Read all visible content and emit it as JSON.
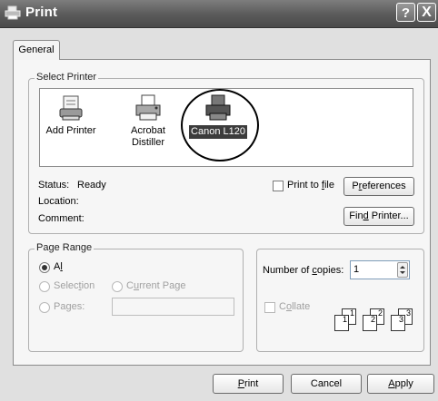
{
  "window": {
    "title": "Print",
    "help_button": "?",
    "close_button": "X"
  },
  "tabs": [
    {
      "label": "General"
    }
  ],
  "select_printer": {
    "legend": "Select Printer",
    "printers": [
      {
        "label": "Add Printer",
        "icon": "add-printer-icon",
        "selected": false
      },
      {
        "label": "Acrobat Distiller",
        "line1": "Acrobat",
        "line2": "Distiller",
        "icon": "printer-icon",
        "selected": false
      },
      {
        "label": "Canon L120",
        "icon": "printer-icon",
        "selected": true
      }
    ],
    "status_label": "Status:",
    "status_value": "Ready",
    "location_label": "Location:",
    "comment_label": "Comment:",
    "print_to_file_pre": "Print to ",
    "print_to_file_key": "f",
    "print_to_file_post": "ile",
    "preferences_pre": "P",
    "preferences_key": "r",
    "preferences_post": "eferences",
    "find_printer_pre": "Fin",
    "find_printer_key": "d",
    "find_printer_post": " Printer..."
  },
  "page_range": {
    "legend": "Page Range",
    "all_key": "l",
    "all_pre": "A",
    "all_post": "",
    "selection_pre": "Selec",
    "selection_key": "t",
    "selection_post": "ion",
    "current_pre": "C",
    "current_key": "u",
    "current_post": "rrent Page",
    "pages_label": "Pages:",
    "pages_value": ""
  },
  "copies": {
    "label_pre": "Number of ",
    "label_key": "c",
    "label_post": "opies:",
    "value": "1",
    "collate_pre": "C",
    "collate_key": "o",
    "collate_post": "llate",
    "page_numbers": [
      "1",
      "1",
      "2",
      "2",
      "3",
      "3"
    ]
  },
  "footer": {
    "print_key": "P",
    "print_post": "rint",
    "cancel": "Cancel",
    "apply_key": "A",
    "apply_post": "pply"
  }
}
